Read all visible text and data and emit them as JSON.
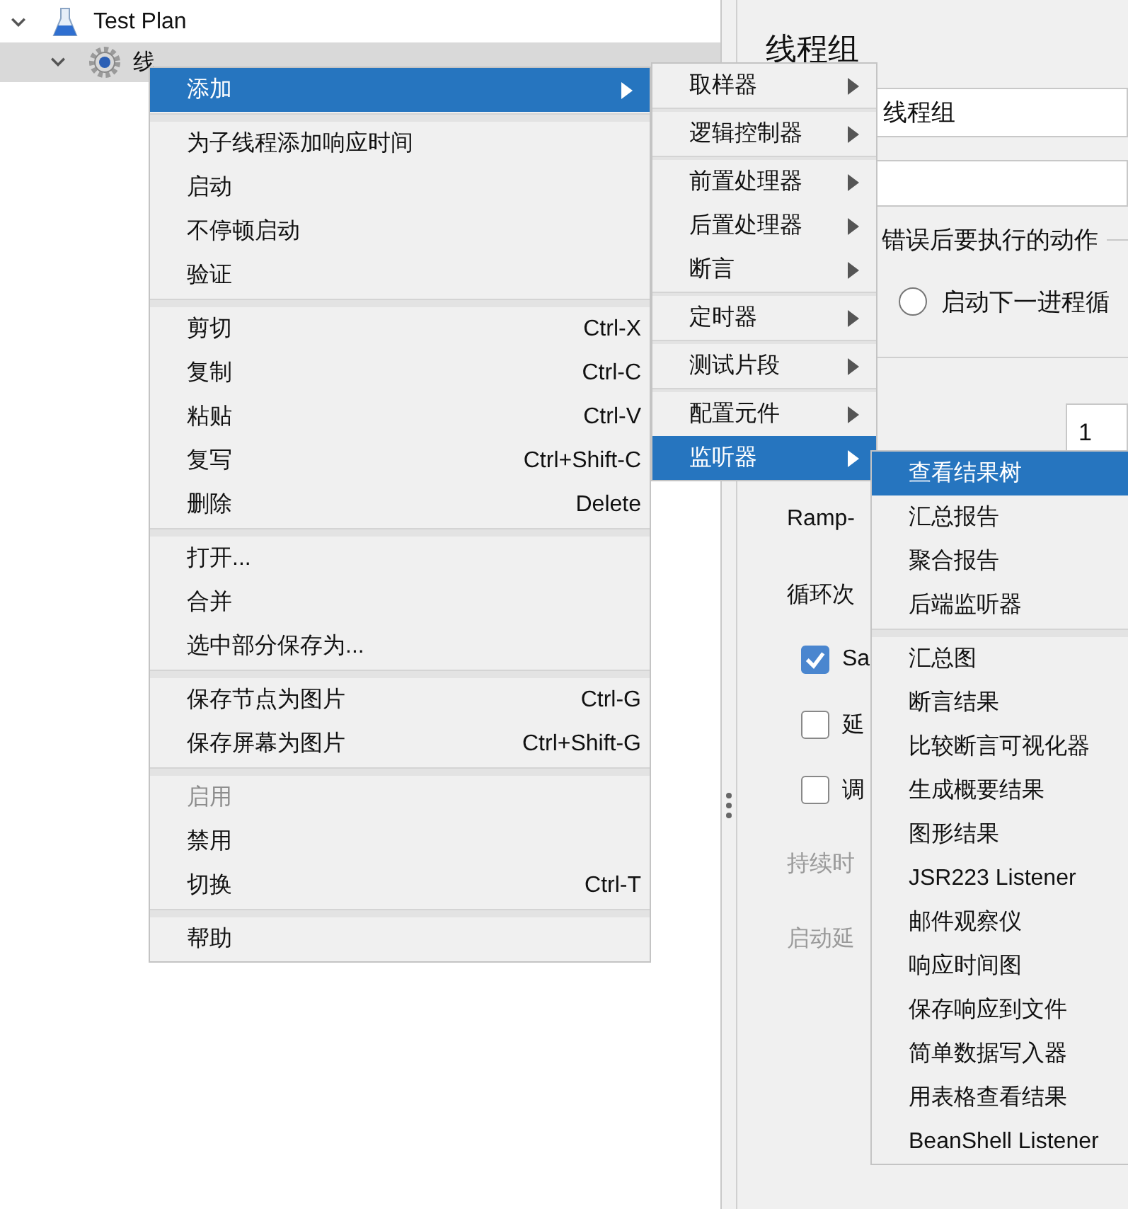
{
  "tree": [
    {
      "label": "Test Plan",
      "expanded": true,
      "selected": false,
      "children": [
        {
          "label": "线",
          "expanded": true,
          "selected": true
        }
      ]
    }
  ],
  "panel": {
    "title": "线程组",
    "name_value": "线程组",
    "error_action_label": "错误后要执行的动作",
    "error_options": [
      {
        "label": "启动下一进程循",
        "selected": false
      }
    ],
    "threads_value": "1",
    "labels": [
      "Ramp-",
      "循环次"
    ],
    "checkboxes": [
      {
        "label": "Sa",
        "checked": true
      },
      {
        "label": "延",
        "checked": false
      },
      {
        "label": "调",
        "checked": false
      }
    ],
    "disabled_labels": [
      "持续时",
      "启动延"
    ]
  },
  "context_menu": {
    "items": [
      {
        "kind": "item",
        "label": "添加",
        "submenu": true,
        "selected": true,
        "disabled": false
      },
      {
        "kind": "separator"
      },
      {
        "kind": "item",
        "label": "为子线程添加响应时间",
        "submenu": false,
        "selected": false,
        "disabled": false
      },
      {
        "kind": "item",
        "label": "启动",
        "submenu": false,
        "selected": false,
        "disabled": false
      },
      {
        "kind": "item",
        "label": "不停顿启动",
        "submenu": false,
        "selected": false,
        "disabled": false
      },
      {
        "kind": "item",
        "label": "验证",
        "submenu": false,
        "selected": false,
        "disabled": false
      },
      {
        "kind": "separator"
      },
      {
        "kind": "item",
        "label": "剪切",
        "shortcut": "Ctrl-X",
        "submenu": false,
        "selected": false,
        "disabled": false
      },
      {
        "kind": "item",
        "label": "复制",
        "shortcut": "Ctrl-C",
        "submenu": false,
        "selected": false,
        "disabled": false
      },
      {
        "kind": "item",
        "label": "粘贴",
        "shortcut": "Ctrl-V",
        "submenu": false,
        "selected": false,
        "disabled": false
      },
      {
        "kind": "item",
        "label": "复写",
        "shortcut": "Ctrl+Shift-C",
        "submenu": false,
        "selected": false,
        "disabled": false
      },
      {
        "kind": "item",
        "label": "删除",
        "shortcut": "Delete",
        "submenu": false,
        "selected": false,
        "disabled": false
      },
      {
        "kind": "separator"
      },
      {
        "kind": "item",
        "label": "打开...",
        "submenu": false,
        "selected": false,
        "disabled": false
      },
      {
        "kind": "item",
        "label": "合并",
        "submenu": false,
        "selected": false,
        "disabled": false
      },
      {
        "kind": "item",
        "label": "选中部分保存为...",
        "submenu": false,
        "selected": false,
        "disabled": false
      },
      {
        "kind": "separator"
      },
      {
        "kind": "item",
        "label": "保存节点为图片",
        "shortcut": "Ctrl-G",
        "submenu": false,
        "selected": false,
        "disabled": false
      },
      {
        "kind": "item",
        "label": "保存屏幕为图片",
        "shortcut": "Ctrl+Shift-G",
        "submenu": false,
        "selected": false,
        "disabled": false
      },
      {
        "kind": "separator"
      },
      {
        "kind": "item",
        "label": "启用",
        "submenu": false,
        "selected": false,
        "disabled": true
      },
      {
        "kind": "item",
        "label": "禁用",
        "submenu": false,
        "selected": false,
        "disabled": false
      },
      {
        "kind": "item",
        "label": "切换",
        "shortcut": "Ctrl-T",
        "submenu": false,
        "selected": false,
        "disabled": false
      },
      {
        "kind": "separator"
      },
      {
        "kind": "item",
        "label": "帮助",
        "submenu": false,
        "selected": false,
        "disabled": false
      }
    ]
  },
  "add_submenu": {
    "items": [
      {
        "kind": "item",
        "label": "取样器",
        "selected": false
      },
      {
        "kind": "separator"
      },
      {
        "kind": "item",
        "label": "逻辑控制器",
        "selected": false
      },
      {
        "kind": "separator"
      },
      {
        "kind": "item",
        "label": "前置处理器",
        "selected": false
      },
      {
        "kind": "item",
        "label": "后置处理器",
        "selected": false
      },
      {
        "kind": "item",
        "label": "断言",
        "selected": false
      },
      {
        "kind": "separator"
      },
      {
        "kind": "item",
        "label": "定时器",
        "selected": false
      },
      {
        "kind": "separator"
      },
      {
        "kind": "item",
        "label": "测试片段",
        "selected": false
      },
      {
        "kind": "separator"
      },
      {
        "kind": "item",
        "label": "配置元件",
        "selected": false
      },
      {
        "kind": "item",
        "label": "监听器",
        "selected": true
      }
    ]
  },
  "listener_submenu": {
    "items": [
      {
        "kind": "item",
        "label": "查看结果树",
        "selected": true
      },
      {
        "kind": "item",
        "label": "汇总报告",
        "selected": false
      },
      {
        "kind": "item",
        "label": "聚合报告",
        "selected": false
      },
      {
        "kind": "item",
        "label": "后端监听器",
        "selected": false
      },
      {
        "kind": "separator"
      },
      {
        "kind": "item",
        "label": "汇总图",
        "selected": false
      },
      {
        "kind": "item",
        "label": "断言结果",
        "selected": false
      },
      {
        "kind": "item",
        "label": "比较断言可视化器",
        "selected": false
      },
      {
        "kind": "item",
        "label": "生成概要结果",
        "selected": false
      },
      {
        "kind": "item",
        "label": "图形结果",
        "selected": false
      },
      {
        "kind": "item",
        "label": "JSR223 Listener",
        "selected": false
      },
      {
        "kind": "item",
        "label": "邮件观察仪",
        "selected": false
      },
      {
        "kind": "item",
        "label": "响应时间图",
        "selected": false
      },
      {
        "kind": "item",
        "label": "保存响应到文件",
        "selected": false
      },
      {
        "kind": "item",
        "label": "简单数据写入器",
        "selected": false
      },
      {
        "kind": "item",
        "label": "用表格查看结果",
        "selected": false
      },
      {
        "kind": "item",
        "label": "BeanShell Listener",
        "selected": false
      }
    ]
  }
}
